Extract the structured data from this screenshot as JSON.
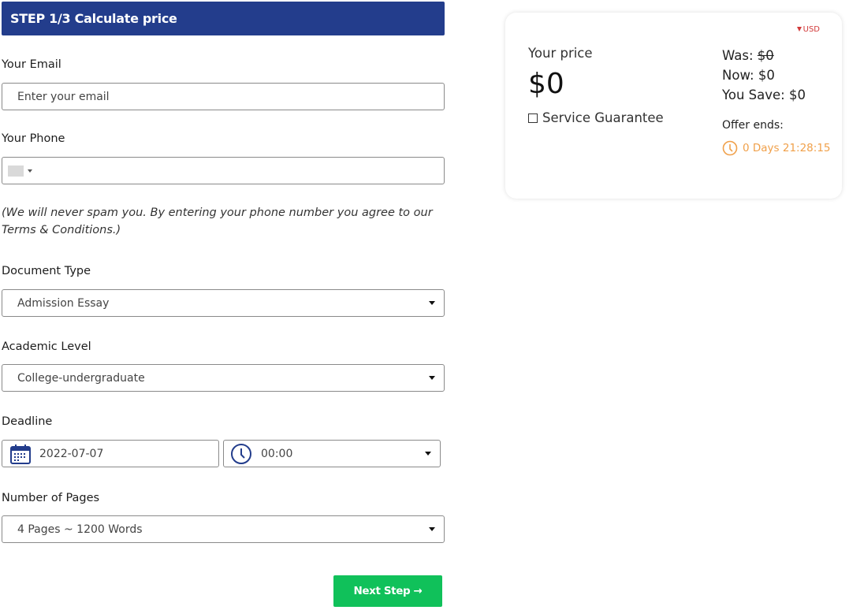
{
  "header": {
    "title": "STEP 1/3 Calculate price"
  },
  "email": {
    "label": "Your Email",
    "placeholder": "Enter your email",
    "value": ""
  },
  "phone": {
    "label": "Your Phone",
    "value": "",
    "flag_icon": "country-flag-placeholder"
  },
  "note": "(We will never spam you. By entering your phone number you agree to our Terms & Conditions.)",
  "document_type": {
    "label": "Document Type",
    "selected": "Admission Essay"
  },
  "academic_level": {
    "label": "Academic Level",
    "selected": "College-undergraduate"
  },
  "deadline": {
    "label": "Deadline",
    "date": "2022-07-07",
    "time": "00:00",
    "date_icon": "calendar-icon",
    "time_icon": "clock-icon"
  },
  "pages": {
    "label": "Number of Pages",
    "selected": "4 Pages ~ 1200 Words"
  },
  "next_button": {
    "label": "Next Step →"
  },
  "price_card": {
    "currency": "USD",
    "your_price_label": "Your price",
    "price": "$0",
    "service_guarantee_label": "Service Guarantee",
    "was_label": "Was:",
    "was_value": "$0",
    "now_label": "Now:",
    "now_value": "$0",
    "save_label": "You Save:",
    "save_value": "$0",
    "offer_ends_label": "Offer ends:",
    "countdown": "0 Days 21:28:15"
  },
  "colors": {
    "header": "#233d8c",
    "button": "#10c15a",
    "timer": "#f0a04a",
    "currency": "#d23a3a"
  }
}
